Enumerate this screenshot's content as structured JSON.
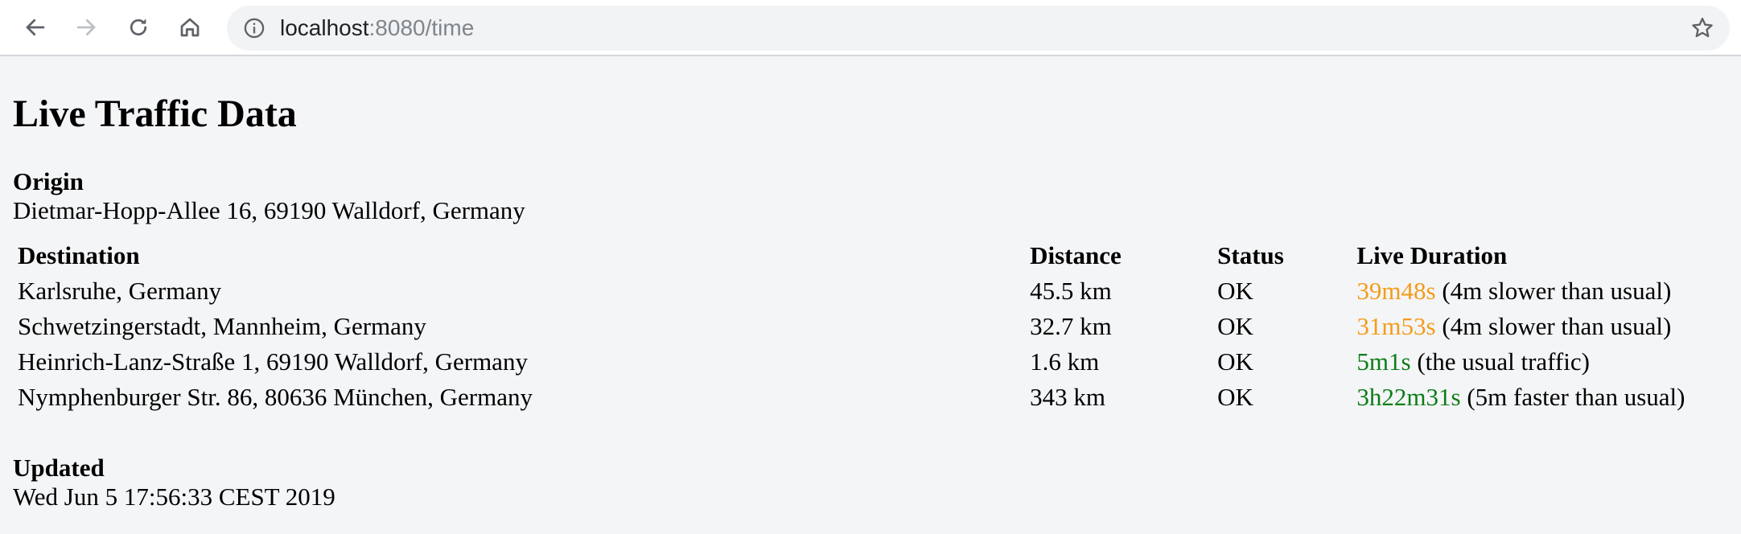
{
  "browser": {
    "url_host": "localhost",
    "url_rest": ":8080/time"
  },
  "page": {
    "title": "Live Traffic Data",
    "origin_label": "Origin",
    "origin_value": "Dietmar-Hopp-Allee 16, 69190 Walldorf, Germany",
    "table": {
      "headers": {
        "destination": "Destination",
        "distance": "Distance",
        "status": "Status",
        "duration": "Live Duration"
      },
      "rows": [
        {
          "destination": "Karlsruhe, Germany",
          "distance": "45.5 km",
          "status": "OK",
          "duration": "39m48s",
          "note": " (4m slower than usual)",
          "trend": "slow"
        },
        {
          "destination": "Schwetzingerstadt, Mannheim, Germany",
          "distance": "32.7 km",
          "status": "OK",
          "duration": "31m53s",
          "note": " (4m slower than usual)",
          "trend": "slow"
        },
        {
          "destination": "Heinrich-Lanz-Straße 1, 69190 Walldorf, Germany",
          "distance": "1.6 km",
          "status": "OK",
          "duration": "5m1s",
          "note": " (the usual traffic)",
          "trend": "fast"
        },
        {
          "destination": "Nymphenburger Str. 86, 80636 München, Germany",
          "distance": "343 km",
          "status": "OK",
          "duration": "3h22m31s",
          "note": " (5m faster than usual)",
          "trend": "fast"
        }
      ]
    },
    "updated_label": "Updated",
    "updated_value": "Wed Jun 5 17:56:33 CEST 2019"
  },
  "colors": {
    "slow": "#f39c1b",
    "fast": "#0b7d16",
    "page_background": "#f4f5f7",
    "omnibox_background": "#f1f3f4"
  },
  "icons": {
    "back": "back-arrow-icon",
    "forward": "forward-arrow-icon",
    "reload": "reload-icon",
    "home": "home-icon",
    "site_info": "info-icon",
    "bookmark": "star-icon"
  }
}
